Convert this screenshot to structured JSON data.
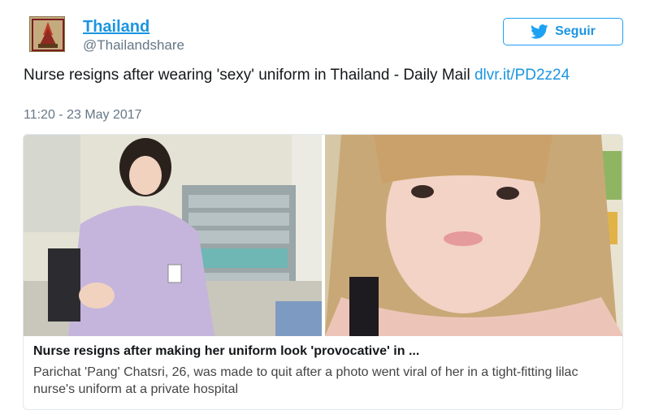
{
  "tweet": {
    "author_name": "Thailand",
    "author_handle": "@Thailandshare",
    "follow_label": "Seguir",
    "text": "Nurse resigns after wearing 'sexy' uniform in Thailand - Daily Mail",
    "link": "dlvr.it/PD2z24",
    "timestamp": "11:20 - 23 May 2017"
  },
  "card": {
    "title": "Nurse resigns after making her uniform look 'provocative' in ...",
    "description": "Parichat 'Pang' Chatsri, 26, was made to quit after a photo went viral of her in a tight-fitting lilac nurse's uniform at a private hospital"
  },
  "colors": {
    "accent": "#1b95e0",
    "border": "#e1e8ed",
    "muted": "#657786"
  },
  "icons": {
    "follow": "twitter-bird-icon",
    "avatar": "temple-logo"
  }
}
